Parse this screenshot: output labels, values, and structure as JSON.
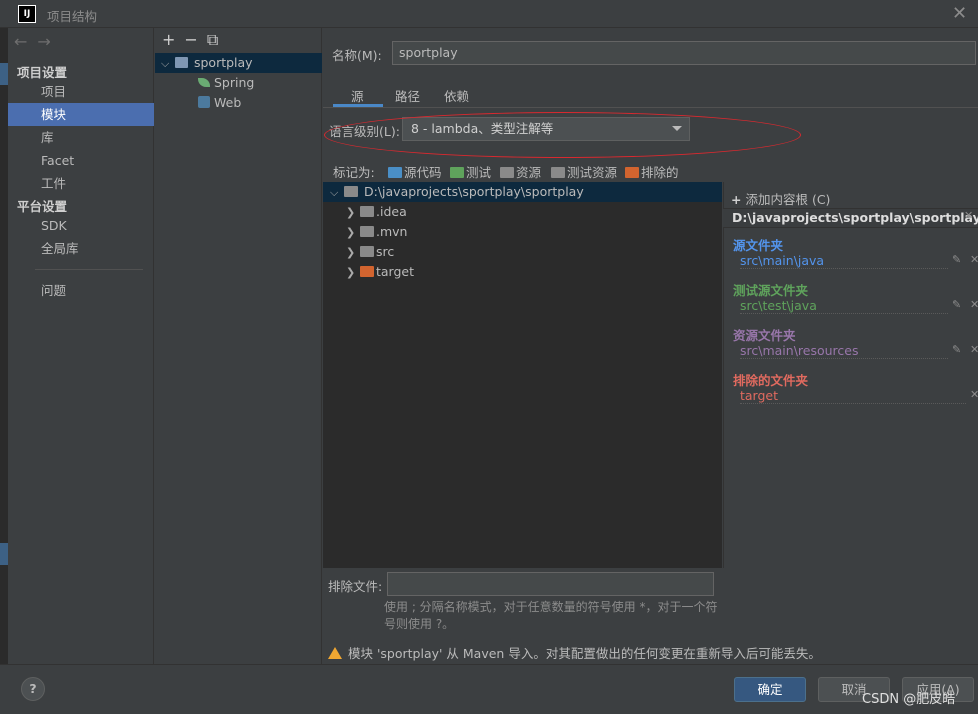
{
  "window": {
    "title": "项目结构",
    "logo": "IJ",
    "close": "✕"
  },
  "nav": {
    "back": "←",
    "forward": "→",
    "project_settings": "项目设置",
    "items1": [
      "项目",
      "模块",
      "库",
      "Facet",
      "工件"
    ],
    "platform_settings": "平台设置",
    "items2": [
      "SDK",
      "全局库"
    ],
    "problems": "问题"
  },
  "tree": {
    "tools": [
      "+",
      "−",
      "⧉"
    ],
    "module": "sportplay",
    "children": [
      "Spring",
      "Web"
    ]
  },
  "main": {
    "name_label": "名称(M):",
    "name_value": "sportplay",
    "tabs": [
      "源",
      "路径",
      "依赖"
    ],
    "lang_label": "语言级别(L):",
    "lang_value": "8 - lambda、类型注解等",
    "mark_as": "标记为:",
    "marks": [
      "源代码",
      "测试",
      "资源",
      "测试资源",
      "排除的"
    ],
    "files": {
      "root": "D:\\javaprojects\\sportplay\\sportplay",
      "children": [
        ".idea",
        ".mvn",
        "src",
        "target"
      ]
    },
    "roots": {
      "add": "添加内容根 (C)",
      "path": "D:\\javaprojects\\sportplay\\sportplay",
      "groups": [
        {
          "title": "源文件夹",
          "path": "src\\main\\java",
          "color": "#5394ec"
        },
        {
          "title": "测试源文件夹",
          "path": "src\\test\\java",
          "color": "#5fa35c"
        },
        {
          "title": "资源文件夹",
          "path": "src\\main\\resources",
          "color": "#9876aa"
        },
        {
          "title": "排除的文件夹",
          "path": "target",
          "color": "#e06a5f"
        }
      ]
    },
    "exclude_label": "排除文件:",
    "exclude_hint": "使用 ; 分隔名称模式，对于任意数量的符号使用 *，对于一个符号则使用 ?。",
    "warning": "模块 'sportplay' 从 Maven 导入。对其配置做出的任何变更在重新导入后可能丢失。"
  },
  "buttons": {
    "help": "?",
    "ok": "确定",
    "cancel": "取消",
    "apply": "应用(A)"
  },
  "watermark": "CSDN @肥皮皓"
}
